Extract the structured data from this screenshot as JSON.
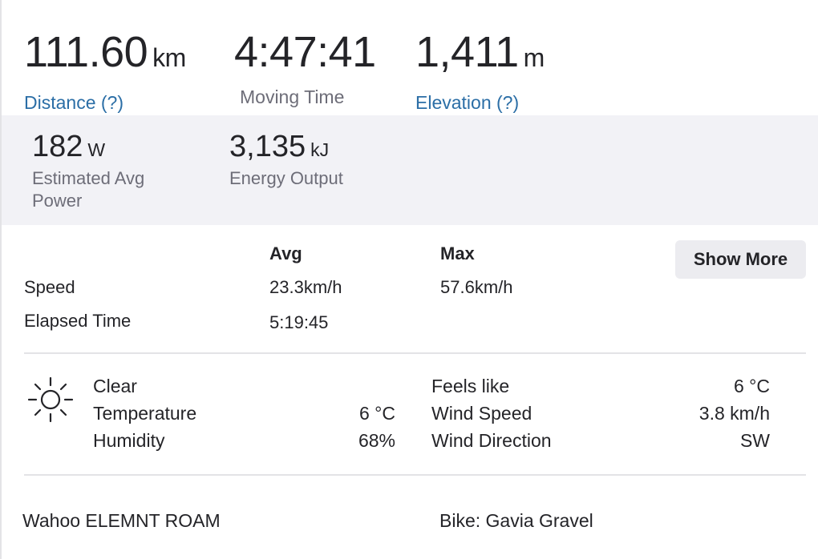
{
  "primary_stats": [
    {
      "value": "111.60",
      "unit": "km",
      "label": "Distance (?)"
    },
    {
      "value": "4:47:41",
      "unit": "",
      "label": "Moving Time"
    },
    {
      "value": "1,411",
      "unit": "m",
      "label": "Elevation (?)"
    }
  ],
  "secondary_stats": [
    {
      "value": "182",
      "unit": "W",
      "label": "Estimated Avg Power"
    },
    {
      "value": "3,135",
      "unit": "kJ",
      "label": "Energy Output"
    }
  ],
  "table": {
    "headers": {
      "avg": "Avg",
      "max": "Max"
    },
    "rows": [
      {
        "label": "Speed",
        "avg": "23.3km/h",
        "max": "57.6km/h"
      },
      {
        "label": "Elapsed Time",
        "avg": "5:19:45",
        "max": ""
      }
    ],
    "show_more_label": "Show More"
  },
  "weather": {
    "icon": "sun-icon",
    "condition": "Clear",
    "left": [
      {
        "label": "Temperature",
        "value": "6 °C"
      },
      {
        "label": "Humidity",
        "value": "68%"
      }
    ],
    "right": [
      {
        "label": "Feels like",
        "value": "6 °C"
      },
      {
        "label": "Wind Speed",
        "value": "3.8 km/h"
      },
      {
        "label": "Wind Direction",
        "value": "SW"
      }
    ]
  },
  "footer": {
    "device": "Wahoo ELEMNT ROAM",
    "bike": "Bike: Gavia Gravel"
  },
  "colors": {
    "link": "#2b6ea6",
    "muted": "#6d6d78",
    "band_bg": "#f2f2f6",
    "text": "#242428"
  }
}
